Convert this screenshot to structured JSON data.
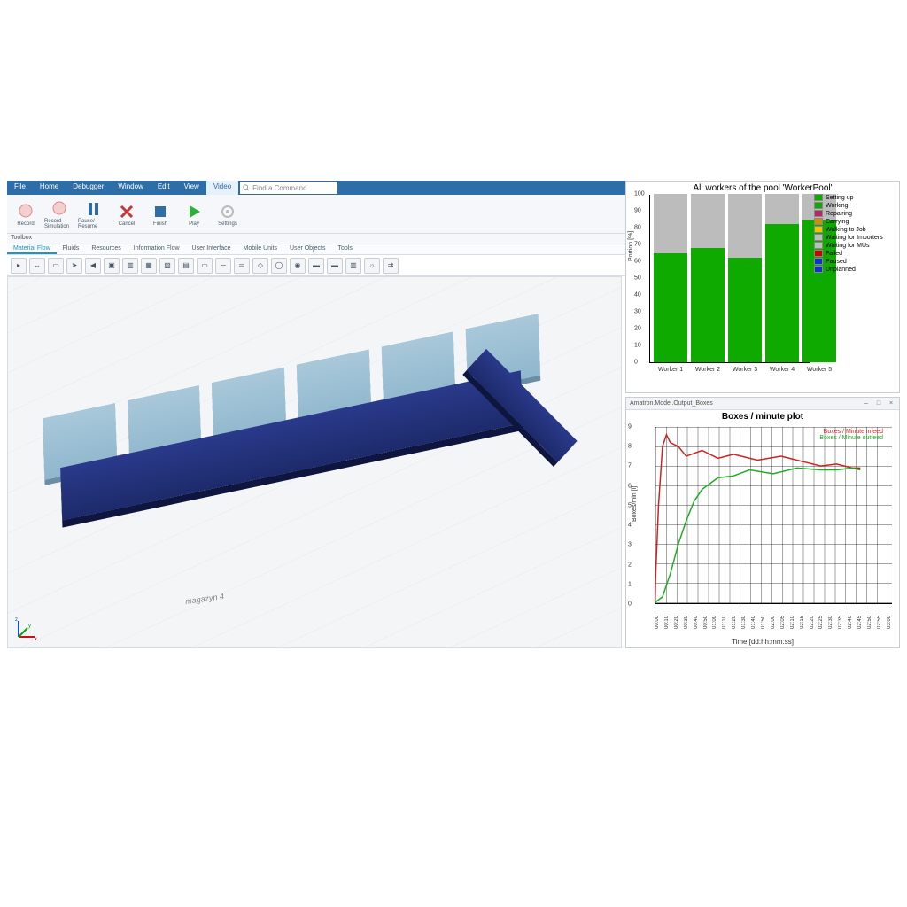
{
  "menu": {
    "items": [
      "File",
      "Home",
      "Debugger",
      "Window",
      "Edit",
      "View",
      "Video"
    ],
    "search_placeholder": "Find a Command"
  },
  "ribbon": {
    "buttons": [
      {
        "id": "record",
        "label": "Record"
      },
      {
        "id": "record-sim",
        "label": "Record Simulation"
      },
      {
        "id": "pause-resume",
        "label": "Pause/ Resume"
      },
      {
        "id": "cancel",
        "label": "Cancel"
      },
      {
        "id": "finish",
        "label": "Finish"
      },
      {
        "id": "play",
        "label": "Play"
      },
      {
        "id": "settings",
        "label": "Settings"
      }
    ]
  },
  "toolbox": {
    "title": "Toolbox",
    "tabs": [
      "Material Flow",
      "Fluids",
      "Resources",
      "Information Flow",
      "User Interface",
      "Mobile Units",
      "User Objects",
      "Tools"
    ]
  },
  "viewport": {
    "floor_label": "magazyn 4"
  },
  "chart_data": [
    {
      "type": "bar",
      "title": "All workers of the pool 'WorkerPool'",
      "ylabel": "Portion [%]",
      "ylim": [
        0,
        100
      ],
      "yticks": [
        0,
        10,
        20,
        30,
        40,
        50,
        60,
        70,
        80,
        90,
        100
      ],
      "categories": [
        "Worker 1",
        "Worker 2",
        "Worker 3",
        "Worker 4",
        "Worker 5"
      ],
      "series": [
        {
          "name": "Setting up",
          "color": "#0eaa00",
          "values": [
            0,
            0,
            0,
            0,
            0
          ]
        },
        {
          "name": "Working",
          "color": "#0eaa00",
          "values": [
            65,
            68,
            62,
            82,
            85
          ]
        },
        {
          "name": "Repairing",
          "color": "#b02a6b",
          "values": [
            0,
            0,
            0,
            0,
            0
          ]
        },
        {
          "name": "Carrying",
          "color": "#d58c00",
          "values": [
            0,
            0,
            0,
            0,
            0
          ]
        },
        {
          "name": "Walking to Job",
          "color": "#f2c200",
          "values": [
            0,
            0,
            0,
            0,
            0
          ]
        },
        {
          "name": "Waiting for Importers",
          "color": "#bcbcbc",
          "values": [
            35,
            32,
            38,
            18,
            15
          ]
        },
        {
          "name": "Waiting for MUs",
          "color": "#bcbcbc",
          "values": [
            0,
            0,
            0,
            0,
            0
          ]
        },
        {
          "name": "Failed",
          "color": "#d10000",
          "values": [
            0,
            0,
            0,
            0,
            0
          ]
        },
        {
          "name": "Paused",
          "color": "#1030d0",
          "values": [
            0,
            0,
            0,
            0,
            0
          ]
        },
        {
          "name": "Unplanned",
          "color": "#1030d0",
          "values": [
            0,
            0,
            0,
            0,
            0
          ]
        }
      ]
    },
    {
      "type": "line",
      "title": "Boxes / minute plot",
      "window_title": "Amatron.Model.Output_Boxes",
      "xlabel": "Time [dd:hh:mm:ss]",
      "ylabel": "Boxes/min [l]",
      "ylim": [
        0,
        9
      ],
      "yticks": [
        0,
        1,
        2,
        3,
        4,
        5,
        6,
        7,
        8,
        9
      ],
      "xticks": [
        "00:00",
        "00:10",
        "00:20",
        "00:30",
        "00:40",
        "00:50",
        "01:00",
        "01:10",
        "01:20",
        "01:30",
        "01:40",
        "01:50",
        "02:00",
        "02:05",
        "02:10",
        "02:15",
        "02:20",
        "02:25",
        "02:30",
        "02:35",
        "02:40",
        "02:45",
        "02:50",
        "02:55",
        "03:00"
      ],
      "series": [
        {
          "name": "Boxes / Minute infeed",
          "color": "#c22",
          "x": [
            0,
            0.05,
            0.1,
            0.15,
            0.2,
            0.3,
            0.4,
            0.6,
            0.8,
            1.0,
            1.3,
            1.6,
            1.9,
            2.1,
            2.3,
            2.5,
            2.6
          ],
          "y": [
            0,
            5.0,
            8.0,
            8.6,
            8.2,
            8.0,
            7.5,
            7.8,
            7.4,
            7.6,
            7.3,
            7.5,
            7.2,
            7.0,
            7.1,
            6.9,
            6.9
          ]
        },
        {
          "name": "Boxes / Minute outfeed",
          "color": "#2a2",
          "x": [
            0,
            0.1,
            0.2,
            0.3,
            0.4,
            0.5,
            0.6,
            0.8,
            1.0,
            1.2,
            1.5,
            1.8,
            2.1,
            2.3,
            2.5,
            2.6
          ],
          "y": [
            0,
            0.3,
            1.5,
            3.0,
            4.2,
            5.2,
            5.8,
            6.4,
            6.5,
            6.8,
            6.6,
            6.9,
            6.8,
            6.8,
            6.9,
            6.8
          ]
        }
      ]
    }
  ]
}
